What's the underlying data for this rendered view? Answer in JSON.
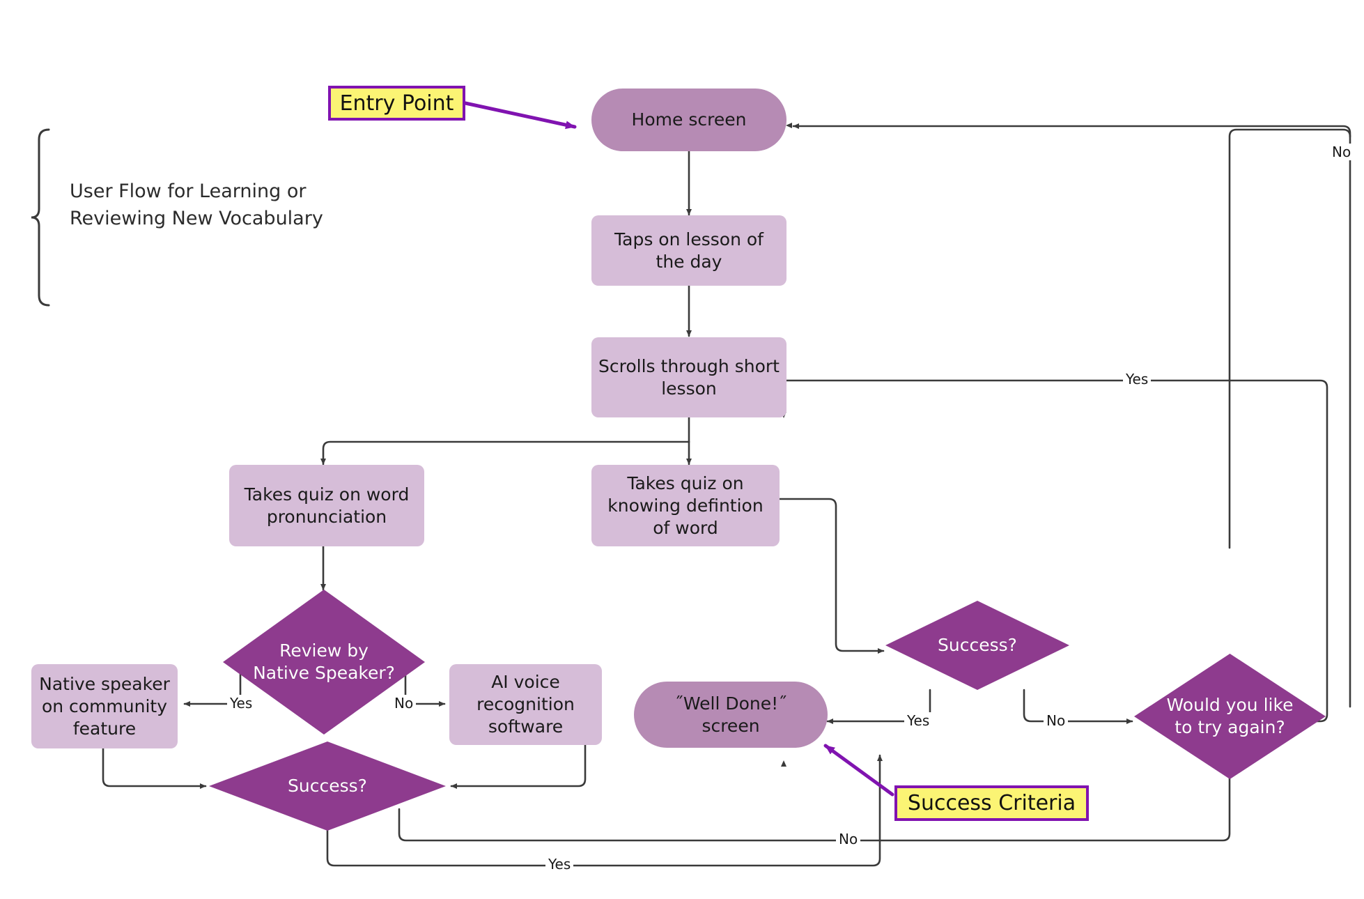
{
  "diagram": {
    "title": "User Flow for Learning or\nReviewing  New Vocabulary",
    "colors": {
      "terminal_fill": "#b68bb4",
      "process_fill": "#d6bdd8",
      "decision_fill": "#8e3b8e",
      "annotation_fill": "#fbf474",
      "annotation_border": "#8013b0",
      "edge_stroke": "#3a3a3a",
      "annotation_arrow": "#8013b0"
    }
  },
  "annotations": [
    {
      "id": "entry",
      "label": "Entry Point"
    },
    {
      "id": "success",
      "label": "Success Criteria"
    }
  ],
  "nodes": [
    {
      "id": "home",
      "type": "terminal",
      "label": "Home screen"
    },
    {
      "id": "taps",
      "type": "process",
      "label": "Taps on lesson of the day"
    },
    {
      "id": "scrolls",
      "type": "process",
      "label": "Scrolls through short lesson"
    },
    {
      "id": "quiz_pron",
      "type": "process",
      "label": "Takes quiz on word pronunciation"
    },
    {
      "id": "quiz_def",
      "type": "process",
      "label": "Takes quiz on knowing defintion of word"
    },
    {
      "id": "review_ns",
      "type": "decision",
      "label": "Review by\nNative Speaker?"
    },
    {
      "id": "native_comm",
      "type": "process",
      "label": "Native speaker on community feature"
    },
    {
      "id": "ai_voice",
      "type": "process",
      "label": "AI voice recognition software"
    },
    {
      "id": "success_l",
      "type": "decision",
      "label": "Success?"
    },
    {
      "id": "success_r",
      "type": "decision",
      "label": "Success?"
    },
    {
      "id": "well_done",
      "type": "terminal",
      "label": "˝Well Done!˝ screen"
    },
    {
      "id": "try_again",
      "type": "decision",
      "label": "Would you like\nto try again?"
    }
  ],
  "edge_labels": [
    {
      "id": "try_again_no_top",
      "text": "No"
    },
    {
      "id": "try_again_yes",
      "text": "Yes"
    },
    {
      "id": "review_yes",
      "text": "Yes"
    },
    {
      "id": "review_no",
      "text": "No"
    },
    {
      "id": "success_l_yes",
      "text": "Yes"
    },
    {
      "id": "success_l_no",
      "text": "No"
    },
    {
      "id": "success_r_yes",
      "text": "Yes"
    },
    {
      "id": "success_r_no",
      "text": "No"
    }
  ]
}
